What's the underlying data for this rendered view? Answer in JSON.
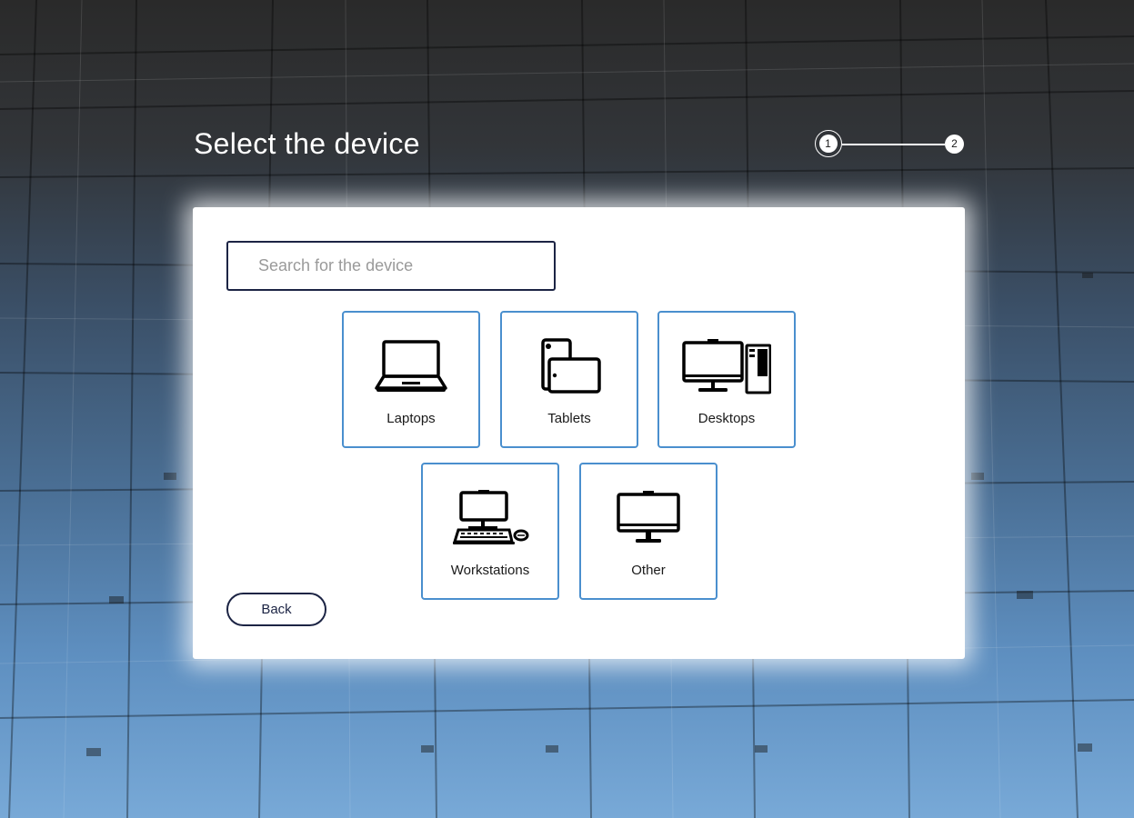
{
  "header": {
    "title": "Select the device"
  },
  "stepper": {
    "steps": [
      "1",
      "2"
    ],
    "active_step": 1
  },
  "search": {
    "placeholder": "Search for the device",
    "value": ""
  },
  "devices": [
    {
      "label": "Laptops",
      "icon": "laptop-icon"
    },
    {
      "label": "Tablets",
      "icon": "tablet-icon"
    },
    {
      "label": "Desktops",
      "icon": "desktop-tower-icon"
    },
    {
      "label": "Workstations",
      "icon": "workstation-icon"
    },
    {
      "label": "Other",
      "icon": "monitor-icon"
    }
  ],
  "actions": {
    "back_label": "Back"
  },
  "colors": {
    "tile_border": "#4a8fce",
    "input_border": "#1c2444",
    "card_bg": "#ffffff"
  }
}
